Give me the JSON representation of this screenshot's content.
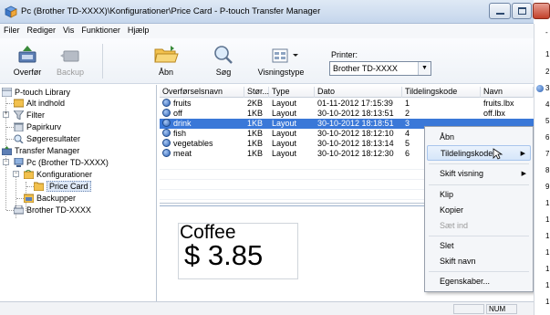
{
  "window": {
    "title": "Pc (Brother TD-XXXX)\\Konfigurationer\\Price Card - P-touch Transfer Manager"
  },
  "menu": [
    "Filer",
    "Rediger",
    "Vis",
    "Funktioner",
    "Hjælp"
  ],
  "toolbar": {
    "transfer": "Overfør",
    "backup": "Backup",
    "open": "Åbn",
    "search": "Søg",
    "view_type": "Visningstype",
    "printer_label": "Printer:",
    "printer_value": "Brother TD-XXXX"
  },
  "tree": {
    "library": "P-touch Library",
    "all": "Alt indhold",
    "filter": "Filter",
    "trash": "Papirkurv",
    "search_results": "Søgeresultater",
    "transfer_manager": "Transfer Manager",
    "pc": "Pc (Brother TD-XXXX)",
    "configs": "Konfigurationer",
    "price_card": "Price Card",
    "backups": "Backupper",
    "printer": "Brother TD-XXXX"
  },
  "files": {
    "headers": [
      "Overførselsnavn",
      "Stør...",
      "Type",
      "Dato",
      "Tildelingskode",
      "Navn"
    ],
    "rows": [
      {
        "name": "fruits",
        "size": "2KB",
        "type": "Layout",
        "date": "01-11-2012 17:15:39",
        "code": "1",
        "file": "fruits.lbx"
      },
      {
        "name": "off",
        "size": "1KB",
        "type": "Layout",
        "date": "30-10-2012 18:13:51",
        "code": "2",
        "file": "off.lbx"
      },
      {
        "name": "drink",
        "size": "1KB",
        "type": "Layout",
        "date": "30-10-2012 18:18:51",
        "code": "3",
        "file": ""
      },
      {
        "name": "fish",
        "size": "1KB",
        "type": "Layout",
        "date": "30-10-2012 18:12:10",
        "code": "4",
        "file": ""
      },
      {
        "name": "vegetables",
        "size": "1KB",
        "type": "Layout",
        "date": "30-10-2012 18:13:14",
        "code": "5",
        "file": ""
      },
      {
        "name": "meat",
        "size": "1KB",
        "type": "Layout",
        "date": "30-10-2012 18:12:30",
        "code": "6",
        "file": ""
      }
    ]
  },
  "preview": {
    "name": "Coffee",
    "price": "$ 3.85"
  },
  "context_menu": {
    "open": "Åbn",
    "assign_code": "Tildelingskode",
    "change_view": "Skift visning",
    "cut": "Klip",
    "copy": "Kopier",
    "paste": "Sæt ind",
    "delete": "Slet",
    "rename": "Skift navn",
    "properties": "Egenskaber..."
  },
  "status": {
    "num": "NUM"
  },
  "background_window": {
    "numbers": [
      "-",
      "1",
      "2",
      "3",
      "4",
      "5",
      "6",
      "7",
      "8",
      "9",
      "1",
      "1",
      "1",
      "1",
      "1",
      "1",
      "1",
      "1",
      "1",
      "1"
    ]
  },
  "colors": {
    "selection": "#3a78d8",
    "titlebar": "#c5d6ec"
  }
}
